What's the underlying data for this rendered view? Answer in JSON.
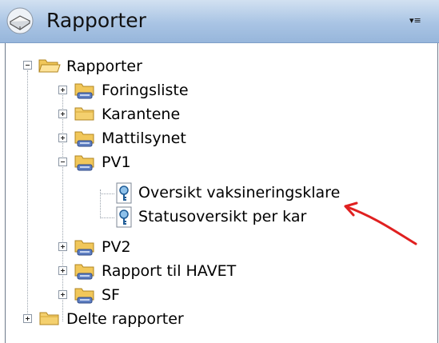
{
  "panel": {
    "title": "Rapporter",
    "menu_glyph": "▾≡",
    "icon": "reports-icon"
  },
  "tree": {
    "root": {
      "label": "Rapporter",
      "icon": "folder-open-icon",
      "expanded": true
    },
    "children": [
      {
        "label": "Foringsliste",
        "icon": "shared-folder-icon",
        "expanded": false
      },
      {
        "label": "Karantene",
        "icon": "folder-icon",
        "expanded": false
      },
      {
        "label": "Mattilsynet",
        "icon": "shared-folder-icon",
        "expanded": false
      },
      {
        "label": "PV1",
        "icon": "shared-folder-icon",
        "expanded": true,
        "reports": [
          {
            "label": "Oversikt vaksineringsklare",
            "icon": "report-key-icon"
          },
          {
            "label": "Statusoversikt per kar",
            "icon": "report-key-icon"
          }
        ]
      },
      {
        "label": "PV2",
        "icon": "shared-folder-icon",
        "expanded": false
      },
      {
        "label": "Rapport til HAVET",
        "icon": "shared-folder-icon",
        "expanded": false
      },
      {
        "label": "SF",
        "icon": "shared-folder-icon",
        "expanded": false
      }
    ],
    "shared_root": {
      "label": "Delte rapporter",
      "icon": "folder-icon",
      "expanded": false
    }
  },
  "annotation": {
    "icon": "red-arrow-icon",
    "color": "#e02020"
  }
}
